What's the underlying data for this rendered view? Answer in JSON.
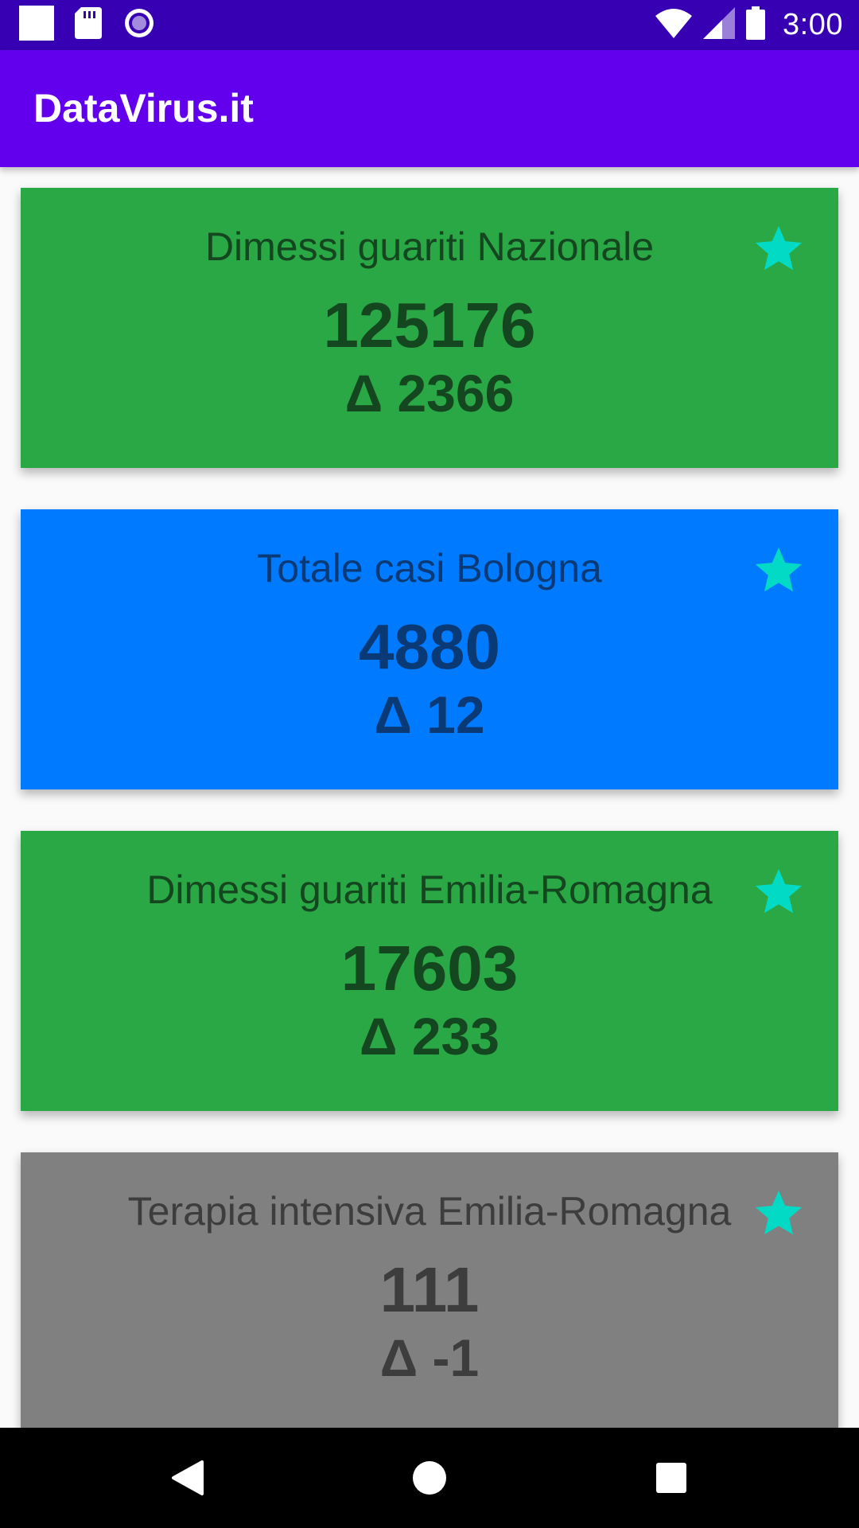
{
  "status_bar": {
    "time": "3:00",
    "icons_left": [
      "notification-square-icon",
      "sd-card-icon",
      "record-icon"
    ],
    "icons_right": [
      "wifi-icon",
      "cell-signal-icon",
      "battery-icon"
    ],
    "background": "#3700b3"
  },
  "app_bar": {
    "title": "DataVirus.it",
    "background": "#6200ee"
  },
  "cards": [
    {
      "title": "Dimessi guariti Nazionale",
      "value": "125176",
      "delta": "Δ 2366",
      "background": "#2aa845",
      "text_color": "#14461f",
      "favorite": true
    },
    {
      "title": "Totale casi Bologna",
      "value": "4880",
      "delta": "Δ 12",
      "background": "#007bff",
      "text_color": "#0a3a75",
      "favorite": true
    },
    {
      "title": "Dimessi guariti Emilia-Romagna",
      "value": "17603",
      "delta": "Δ 233",
      "background": "#2aa845",
      "text_color": "#14461f",
      "favorite": true
    },
    {
      "title": "Terapia intensiva Emilia-Romagna",
      "value": "111",
      "delta": "Δ -1",
      "background": "#808080",
      "text_color": "#3d3d3d",
      "favorite": true
    }
  ],
  "star_color": "#03dac5",
  "nav_bar": {
    "buttons": [
      "back-icon",
      "home-icon",
      "recents-icon"
    ]
  }
}
